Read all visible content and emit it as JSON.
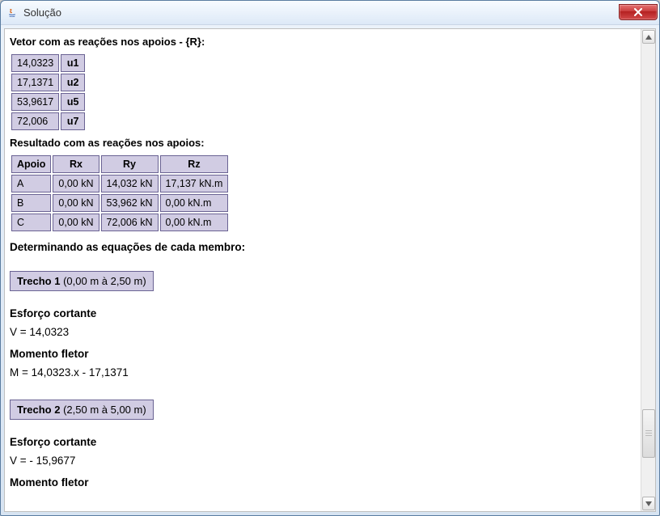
{
  "window": {
    "title": "Solução"
  },
  "headings": {
    "vetor": "Vetor com as reações nos apoios - {R}:",
    "resultado": "Resultado com as reações nos apoios:",
    "determinando": "Determinando as equações de cada membro:",
    "esforco": "Esforço cortante",
    "momento": "Momento fletor"
  },
  "vetorR": [
    {
      "val": "14,0323",
      "u": "u1"
    },
    {
      "val": "17,1371",
      "u": "u2"
    },
    {
      "val": "53,9617",
      "u": "u5"
    },
    {
      "val": "72,006",
      "u": "u7"
    }
  ],
  "reactionsHeader": {
    "c0": "Apoio",
    "c1": "Rx",
    "c2": "Ry",
    "c3": "Rz"
  },
  "reactions": [
    {
      "apoio": "A",
      "rx": "0,00 kN",
      "ry": "14,032 kN",
      "rz": "17,137 kN.m"
    },
    {
      "apoio": "B",
      "rx": "0,00 kN",
      "ry": "53,962 kN",
      "rz": "0,00 kN.m"
    },
    {
      "apoio": "C",
      "rx": "0,00 kN",
      "ry": "72,006 kN",
      "rz": "0,00 kN.m"
    }
  ],
  "trechos": [
    {
      "label_bold": "Trecho 1",
      "label_rest": " (0,00 m à 2,50 m)",
      "v": "V = 14,0323",
      "m": "M = 14,0323.x - 17,1371"
    },
    {
      "label_bold": "Trecho 2",
      "label_rest": " (2,50 m à 5,00 m)",
      "v": "V = - 15,9677",
      "m": ""
    }
  ]
}
